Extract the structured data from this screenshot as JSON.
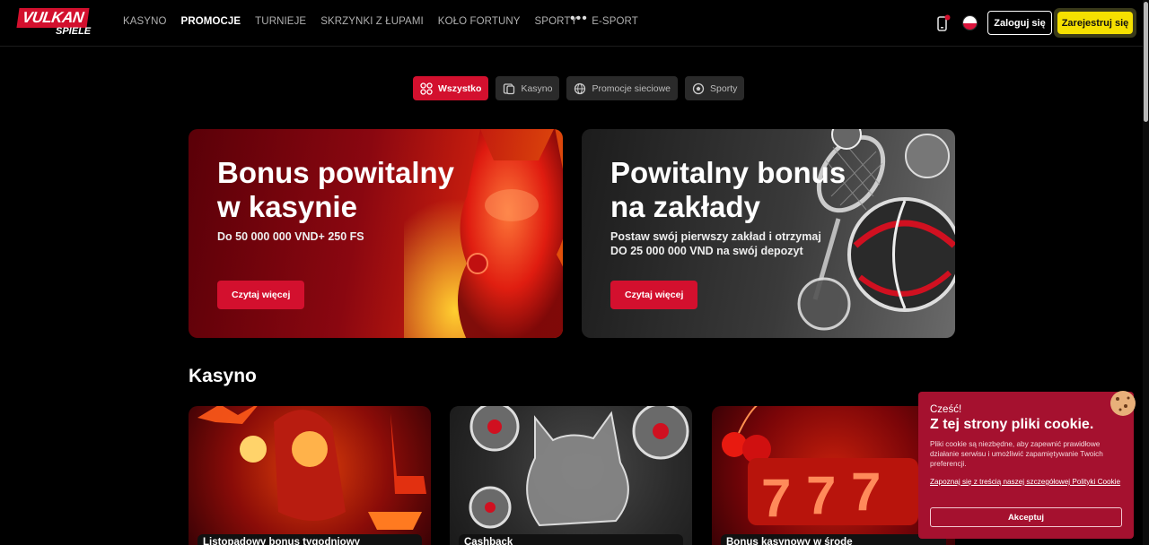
{
  "header": {
    "logo_main": "VULKAN",
    "logo_sub": "SPIELE",
    "nav": [
      "KASYNO",
      "PROMOCJE",
      "TURNIEJE",
      "SKRZYNKI Z ŁUPAMI",
      "KOŁO FORTUNY",
      "SPORTY",
      "E-SPORT"
    ],
    "nav_active": "PROMOCJE",
    "more_icon": "ellipsis-icon",
    "login": "Zaloguj się",
    "register": "Zarejestruj się",
    "flag": "poland-flag-icon"
  },
  "tabs": [
    {
      "label": "Wszystko",
      "icon": "grid-icon",
      "active": true
    },
    {
      "label": "Kasyno",
      "icon": "casino-icon",
      "active": false
    },
    {
      "label": "Promocje sieciowe",
      "icon": "globe-icon",
      "active": false
    },
    {
      "label": "Sporty",
      "icon": "ball-icon",
      "active": false
    }
  ],
  "hero": [
    {
      "title_line1": "Bonus powitalny",
      "title_line2": "w kasynie",
      "sub_line1": "Do 50 000 000 VND+ 250 FS",
      "sub_line2": "",
      "button": "Czytaj więcej"
    },
    {
      "title_line1": "Powitalny bonus",
      "title_line2": "na zakłady",
      "sub_line1": "Postaw swój pierwszy zakład i otrzymaj",
      "sub_line2": "DO 25 000 000 VND na swój depozyt",
      "button": "Czytaj więcej"
    }
  ],
  "section_title": "Kasyno",
  "cards": [
    {
      "label": "Listopadowy bonus tygodniowy"
    },
    {
      "label": "Cashback"
    },
    {
      "label": "Bonus kasynowy w środę"
    }
  ],
  "cookie": {
    "hello": "Cześć!",
    "title": "Z tej strony pliki cookie.",
    "text": "Pliki cookie są niezbędne, aby zapewnić prawidłowe działanie serwisu i umożliwić zapamiętywanie Twoich preferencji.",
    "link": "Zapoznaj się z treścią naszej szczegółowej Polityki Cookie",
    "accept": "Akceptuj"
  },
  "colors": {
    "brand_red": "#d3102e",
    "register_yellow": "#f5e000",
    "cookie_bg": "#a5112f"
  }
}
